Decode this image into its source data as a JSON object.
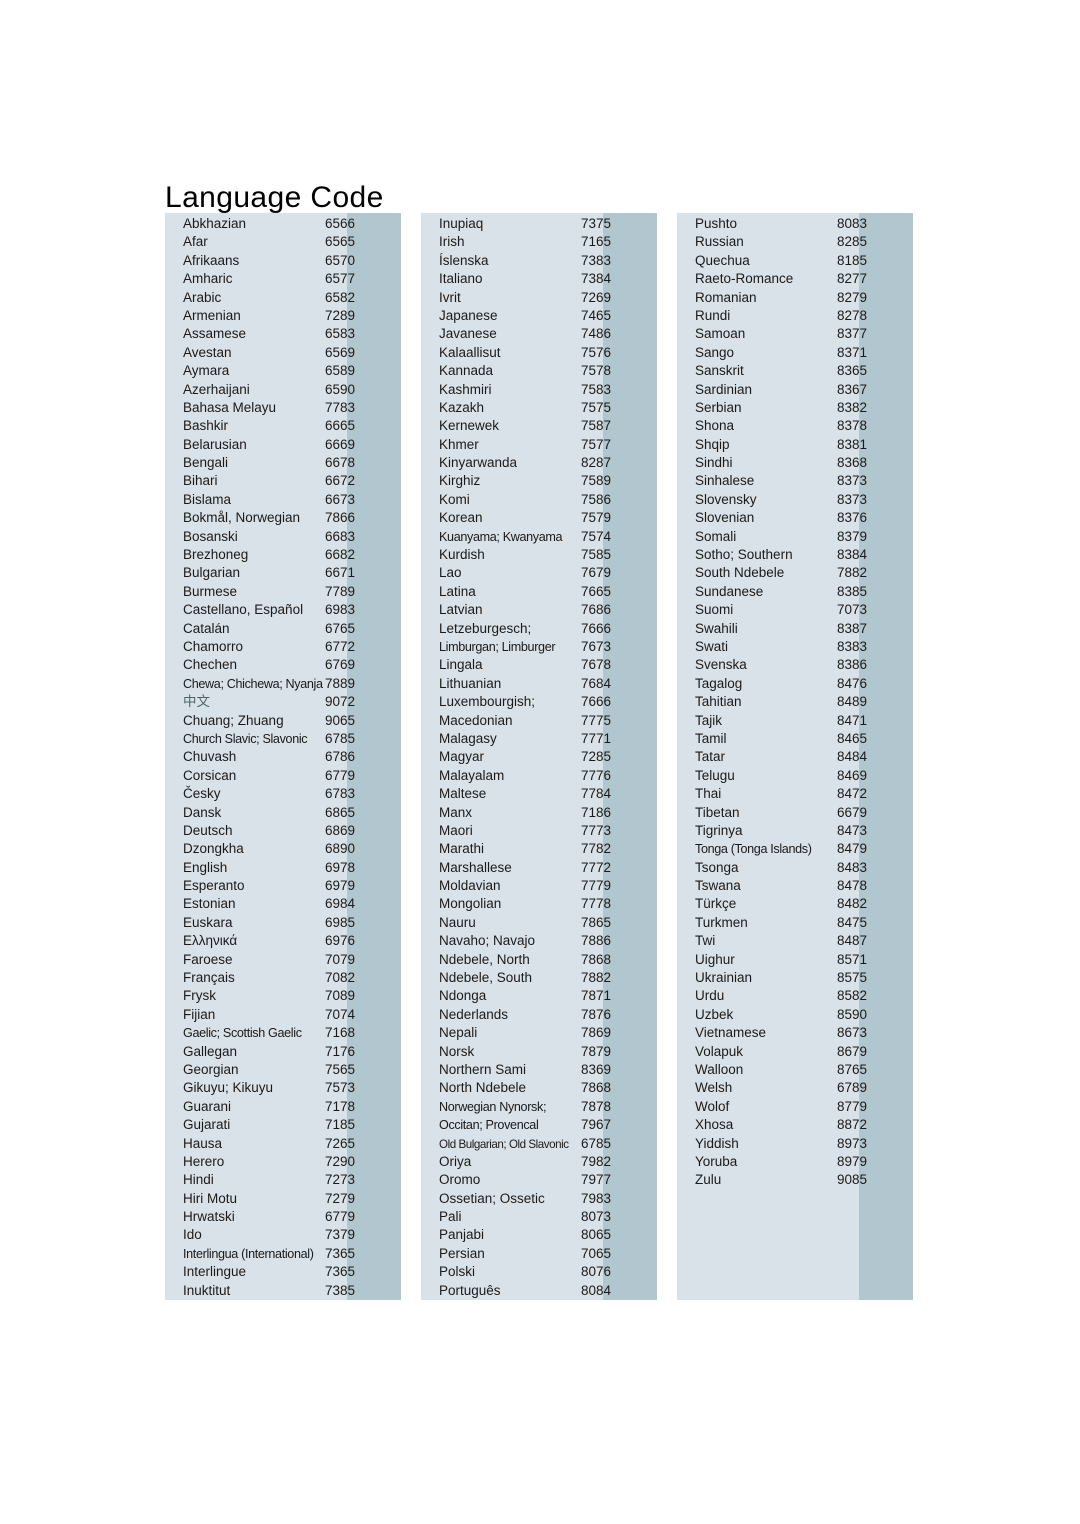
{
  "document": {
    "title": "Language Code",
    "colors": {
      "column_background": "#d9e2e8",
      "code_strip_background": "#b2c6d0",
      "page_background": "#ffffff",
      "text": "#1a1a1a"
    }
  },
  "columns": [
    {
      "id": "column-1",
      "entries": [
        {
          "name": "Abkhazian",
          "code": "6566"
        },
        {
          "name": "Afar",
          "code": "6565"
        },
        {
          "name": "Afrikaans",
          "code": "6570"
        },
        {
          "name": "Amharic",
          "code": "6577"
        },
        {
          "name": "Arabic",
          "code": "6582"
        },
        {
          "name": "Armenian",
          "code": "7289"
        },
        {
          "name": "Assamese",
          "code": "6583"
        },
        {
          "name": "Avestan",
          "code": "6569"
        },
        {
          "name": "Aymara",
          "code": "6589"
        },
        {
          "name": "Azerhaijani",
          "code": "6590"
        },
        {
          "name": "Bahasa Melayu",
          "code": "7783"
        },
        {
          "name": "Bashkir",
          "code": "6665"
        },
        {
          "name": "Belarusian",
          "code": "6669"
        },
        {
          "name": "Bengali",
          "code": "6678"
        },
        {
          "name": "Bihari",
          "code": "6672"
        },
        {
          "name": "Bislama",
          "code": "6673"
        },
        {
          "name": "Bokmål, Norwegian",
          "code": "7866"
        },
        {
          "name": "Bosanski",
          "code": "6683"
        },
        {
          "name": "Brezhoneg",
          "code": "6682"
        },
        {
          "name": "Bulgarian",
          "code": "6671"
        },
        {
          "name": "Burmese",
          "code": "7789"
        },
        {
          "name": "Castellano, Español",
          "code": "6983"
        },
        {
          "name": "Catalán",
          "code": "6765"
        },
        {
          "name": "Chamorro",
          "code": "6772"
        },
        {
          "name": "Chechen",
          "code": "6769"
        },
        {
          "name": "Chewa; Chichewa; Nyanja",
          "code": "7889",
          "fit": "squeeze"
        },
        {
          "name": "中文",
          "code": "9072",
          "fit": "cjk"
        },
        {
          "name": "Chuang; Zhuang",
          "code": "9065"
        },
        {
          "name": "Church Slavic; Slavonic",
          "code": "6785",
          "fit": "squeeze"
        },
        {
          "name": "Chuvash",
          "code": "6786"
        },
        {
          "name": "Corsican",
          "code": "6779"
        },
        {
          "name": "Česky",
          "code": "6783"
        },
        {
          "name": "Dansk",
          "code": "6865"
        },
        {
          "name": "Deutsch",
          "code": "6869"
        },
        {
          "name": "Dzongkha",
          "code": "6890"
        },
        {
          "name": "English",
          "code": "6978"
        },
        {
          "name": "Esperanto",
          "code": "6979"
        },
        {
          "name": "Estonian",
          "code": "6984"
        },
        {
          "name": "Euskara",
          "code": "6985"
        },
        {
          "name": "Ελληνικά",
          "code": "6976"
        },
        {
          "name": "Faroese",
          "code": "7079"
        },
        {
          "name": "Français",
          "code": "7082"
        },
        {
          "name": "Frysk",
          "code": "7089"
        },
        {
          "name": "Fijian",
          "code": "7074"
        },
        {
          "name": "Gaelic; Scottish Gaelic",
          "code": "7168",
          "fit": "squeeze"
        },
        {
          "name": "Gallegan",
          "code": "7176"
        },
        {
          "name": "Georgian",
          "code": "7565"
        },
        {
          "name": "Gikuyu; Kikuyu",
          "code": "7573"
        },
        {
          "name": "Guarani",
          "code": "7178"
        },
        {
          "name": "Gujarati",
          "code": "7185"
        },
        {
          "name": "Hausa",
          "code": "7265"
        },
        {
          "name": "Herero",
          "code": "7290"
        },
        {
          "name": "Hindi",
          "code": "7273"
        },
        {
          "name": "Hiri Motu",
          "code": "7279"
        },
        {
          "name": "Hrwatski",
          "code": "6779"
        },
        {
          "name": "Ido",
          "code": "7379"
        },
        {
          "name": "Interlingua (International)",
          "code": "7365",
          "fit": "squeeze"
        },
        {
          "name": "Interlingue",
          "code": "7365"
        },
        {
          "name": "Inuktitut",
          "code": "7385"
        }
      ]
    },
    {
      "id": "column-2",
      "entries": [
        {
          "name": "Inupiaq",
          "code": "7375"
        },
        {
          "name": "Irish",
          "code": "7165"
        },
        {
          "name": "Íslenska",
          "code": "7383"
        },
        {
          "name": "Italiano",
          "code": "7384"
        },
        {
          "name": "Ivrit",
          "code": "7269"
        },
        {
          "name": "Japanese",
          "code": "7465"
        },
        {
          "name": "Javanese",
          "code": "7486"
        },
        {
          "name": "Kalaallisut",
          "code": "7576"
        },
        {
          "name": "Kannada",
          "code": "7578"
        },
        {
          "name": "Kashmiri",
          "code": "7583"
        },
        {
          "name": "Kazakh",
          "code": "7575"
        },
        {
          "name": "Kernewek",
          "code": "7587"
        },
        {
          "name": "Khmer",
          "code": "7577"
        },
        {
          "name": "Kinyarwanda",
          "code": "8287"
        },
        {
          "name": "Kirghiz",
          "code": "7589"
        },
        {
          "name": "Komi",
          "code": "7586"
        },
        {
          "name": "Korean",
          "code": "7579"
        },
        {
          "name": "Kuanyama; Kwanyama",
          "code": "7574",
          "fit": "squeeze"
        },
        {
          "name": "Kurdish",
          "code": "7585"
        },
        {
          "name": "Lao",
          "code": "7679"
        },
        {
          "name": "Latina",
          "code": "7665"
        },
        {
          "name": "Latvian",
          "code": "7686"
        },
        {
          "name": "Letzeburgesch;",
          "code": "7666"
        },
        {
          "name": "Limburgan; Limburger",
          "code": "7673",
          "fit": "squeeze"
        },
        {
          "name": "Lingala",
          "code": "7678"
        },
        {
          "name": "Lithuanian",
          "code": "7684"
        },
        {
          "name": "Luxembourgish;",
          "code": "7666"
        },
        {
          "name": "Macedonian",
          "code": "7775"
        },
        {
          "name": "Malagasy",
          "code": "7771"
        },
        {
          "name": "Magyar",
          "code": "7285"
        },
        {
          "name": "Malayalam",
          "code": "7776"
        },
        {
          "name": "Maltese",
          "code": "7784"
        },
        {
          "name": "Manx",
          "code": "7186"
        },
        {
          "name": "Maori",
          "code": "7773"
        },
        {
          "name": "Marathi",
          "code": "7782"
        },
        {
          "name": "Marshallese",
          "code": "7772"
        },
        {
          "name": "Moldavian",
          "code": "7779"
        },
        {
          "name": "Mongolian",
          "code": "7778"
        },
        {
          "name": "Nauru",
          "code": "7865"
        },
        {
          "name": "Navaho; Navajo",
          "code": "7886"
        },
        {
          "name": "Ndebele, North",
          "code": "7868"
        },
        {
          "name": "Ndebele, South",
          "code": "7882"
        },
        {
          "name": "Ndonga",
          "code": "7871"
        },
        {
          "name": "Nederlands",
          "code": "7876"
        },
        {
          "name": "Nepali",
          "code": "7869"
        },
        {
          "name": "Norsk",
          "code": "7879"
        },
        {
          "name": "Northern Sami",
          "code": "8369"
        },
        {
          "name": "North Ndebele",
          "code": "7868"
        },
        {
          "name": "Norwegian Nynorsk;",
          "code": "7878",
          "fit": "squeeze"
        },
        {
          "name": "Occitan; Provencal",
          "code": "7967",
          "fit": "squeeze"
        },
        {
          "name": "Old Bulgarian; Old Slavonic",
          "code": "6785",
          "fit": "tiny"
        },
        {
          "name": "Oriya",
          "code": "7982"
        },
        {
          "name": "Oromo",
          "code": "7977"
        },
        {
          "name": "Ossetian; Ossetic",
          "code": "7983"
        },
        {
          "name": "Pali",
          "code": "8073"
        },
        {
          "name": "Panjabi",
          "code": "8065"
        },
        {
          "name": "Persian",
          "code": "7065"
        },
        {
          "name": "Polski",
          "code": "8076"
        },
        {
          "name": "Português",
          "code": "8084"
        }
      ]
    },
    {
      "id": "column-3",
      "entries": [
        {
          "name": "Pushto",
          "code": "8083"
        },
        {
          "name": "Russian",
          "code": "8285"
        },
        {
          "name": "Quechua",
          "code": "8185"
        },
        {
          "name": "Raeto-Romance",
          "code": "8277"
        },
        {
          "name": "Romanian",
          "code": "8279"
        },
        {
          "name": "Rundi",
          "code": "8278"
        },
        {
          "name": "Samoan",
          "code": "8377"
        },
        {
          "name": "Sango",
          "code": "8371"
        },
        {
          "name": "Sanskrit",
          "code": "8365"
        },
        {
          "name": "Sardinian",
          "code": "8367"
        },
        {
          "name": "Serbian",
          "code": "8382"
        },
        {
          "name": "Shona",
          "code": "8378"
        },
        {
          "name": "Shqip",
          "code": "8381"
        },
        {
          "name": "Sindhi",
          "code": "8368"
        },
        {
          "name": "Sinhalese",
          "code": "8373"
        },
        {
          "name": "Slovensky",
          "code": "8373"
        },
        {
          "name": "Slovenian",
          "code": "8376"
        },
        {
          "name": "Somali",
          "code": "8379"
        },
        {
          "name": "Sotho; Southern",
          "code": "8384"
        },
        {
          "name": "South Ndebele",
          "code": "7882"
        },
        {
          "name": "Sundanese",
          "code": "8385"
        },
        {
          "name": "Suomi",
          "code": "7073"
        },
        {
          "name": "Swahili",
          "code": "8387"
        },
        {
          "name": "Swati",
          "code": "8383"
        },
        {
          "name": "Svenska",
          "code": "8386"
        },
        {
          "name": "Tagalog",
          "code": "8476"
        },
        {
          "name": "Tahitian",
          "code": "8489"
        },
        {
          "name": "Tajik",
          "code": "8471"
        },
        {
          "name": "Tamil",
          "code": "8465"
        },
        {
          "name": "Tatar",
          "code": "8484"
        },
        {
          "name": "Telugu",
          "code": "8469"
        },
        {
          "name": "Thai",
          "code": "8472"
        },
        {
          "name": "Tibetan",
          "code": "6679"
        },
        {
          "name": "Tigrinya",
          "code": "8473"
        },
        {
          "name": "Tonga (Tonga Islands)",
          "code": "8479",
          "fit": "squeeze"
        },
        {
          "name": "Tsonga",
          "code": "8483"
        },
        {
          "name": "Tswana",
          "code": "8478"
        },
        {
          "name": "Türkçe",
          "code": "8482"
        },
        {
          "name": "Turkmen",
          "code": "8475"
        },
        {
          "name": "Twi",
          "code": "8487"
        },
        {
          "name": "Uighur",
          "code": "8571"
        },
        {
          "name": "Ukrainian",
          "code": "8575"
        },
        {
          "name": "Urdu",
          "code": "8582"
        },
        {
          "name": "Uzbek",
          "code": "8590"
        },
        {
          "name": "Vietnamese",
          "code": "8673"
        },
        {
          "name": "Volapuk",
          "code": "8679"
        },
        {
          "name": "Walloon",
          "code": "8765"
        },
        {
          "name": "Welsh",
          "code": "6789"
        },
        {
          "name": "Wolof",
          "code": "8779"
        },
        {
          "name": "Xhosa",
          "code": "8872"
        },
        {
          "name": "Yiddish",
          "code": "8973"
        },
        {
          "name": "Yoruba",
          "code": "8979"
        },
        {
          "name": "Zulu",
          "code": "9085"
        }
      ]
    }
  ]
}
